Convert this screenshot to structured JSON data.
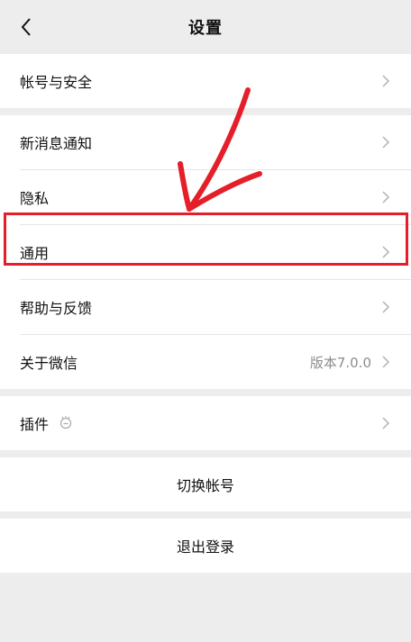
{
  "nav": {
    "title": "设置",
    "back_icon": "chevron-left-icon"
  },
  "groups": [
    {
      "items": [
        {
          "label": "帐号与安全"
        }
      ]
    },
    {
      "items": [
        {
          "label": "新消息通知"
        },
        {
          "label": "隐私"
        },
        {
          "label": "通用"
        },
        {
          "label": "帮助与反馈"
        },
        {
          "label": "关于微信",
          "value": "版本7.0.0"
        }
      ]
    },
    {
      "items": [
        {
          "label": "插件",
          "icon": "plugin-bulb-icon"
        }
      ]
    }
  ],
  "actions": {
    "switch_account": "切换帐号",
    "logout": "退出登录"
  },
  "annotation": {
    "highlight_color": "#e51f2a",
    "arrow_icon": "red-arrow-icon"
  },
  "colors": {
    "background": "#ededed",
    "row": "#ffffff",
    "secondary_text": "#8c8c8c"
  }
}
